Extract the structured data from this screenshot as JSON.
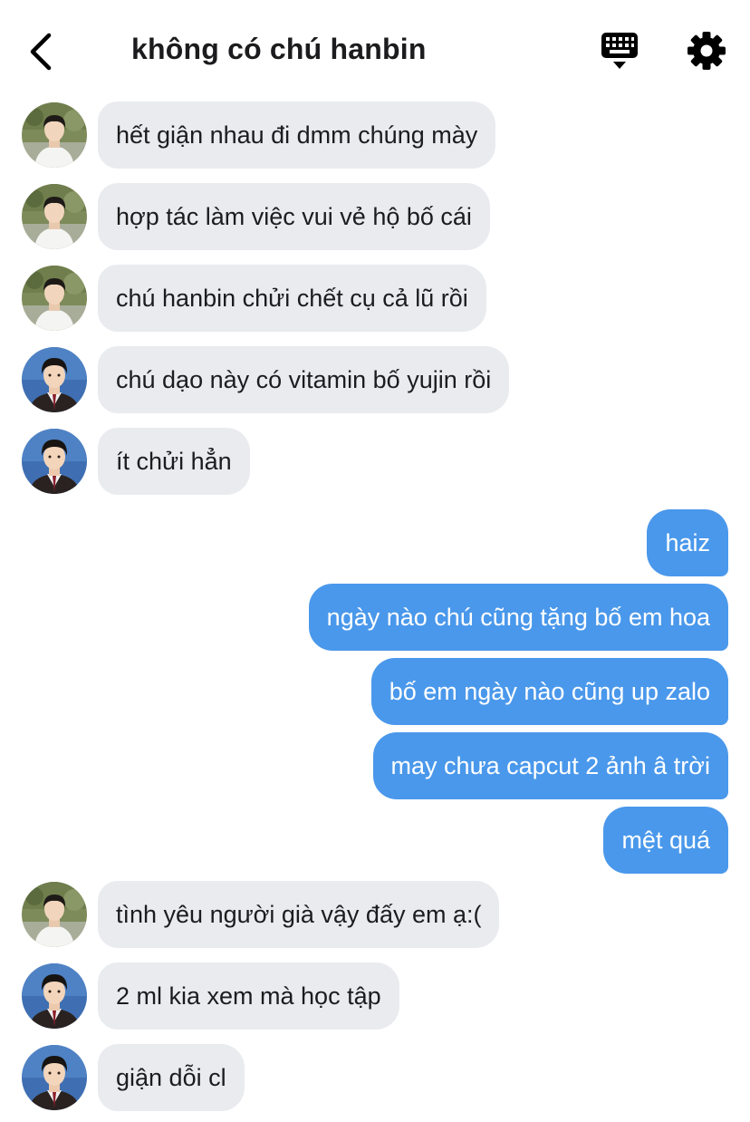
{
  "header": {
    "title": "không có chú hanbin",
    "back_icon": "chevron-left-icon",
    "keyboard_icon": "keyboard-icon",
    "settings_icon": "gear-icon"
  },
  "colors": {
    "incoming_bubble": "#e9ebef",
    "outgoing_bubble": "#4a98eb",
    "text_dark": "#1c1c1e"
  },
  "messages": [
    {
      "side": "in",
      "avatar": "avatar-white-shirt",
      "text": "hết giận nhau đi dmm chúng mày"
    },
    {
      "side": "in",
      "avatar": "avatar-white-shirt",
      "text": "hợp tác làm việc vui vẻ hộ bố cái"
    },
    {
      "side": "in",
      "avatar": "avatar-white-shirt",
      "text": "chú hanbin chửi chết cụ cả lũ rồi"
    },
    {
      "side": "in",
      "avatar": "avatar-uniform",
      "text": "chú dạo này có vitamin bố yujin rồi"
    },
    {
      "side": "in",
      "avatar": "avatar-uniform",
      "text": "ít chửi hẳn"
    },
    {
      "side": "out",
      "text": "haiz"
    },
    {
      "side": "out",
      "text": "ngày nào chú cũng tặng bố em hoa"
    },
    {
      "side": "out",
      "text": "bố em ngày nào cũng up zalo"
    },
    {
      "side": "out",
      "text": "may chưa capcut 2 ảnh â trời"
    },
    {
      "side": "out",
      "text": "mệt quá"
    },
    {
      "side": "in",
      "avatar": "avatar-white-shirt",
      "text": "tình yêu người già vậy đấy em ạ:("
    },
    {
      "side": "in",
      "avatar": "avatar-uniform",
      "text": "2 ml kia xem mà học tập"
    },
    {
      "side": "in",
      "avatar": "avatar-uniform",
      "text": "giận dỗi cl"
    }
  ]
}
